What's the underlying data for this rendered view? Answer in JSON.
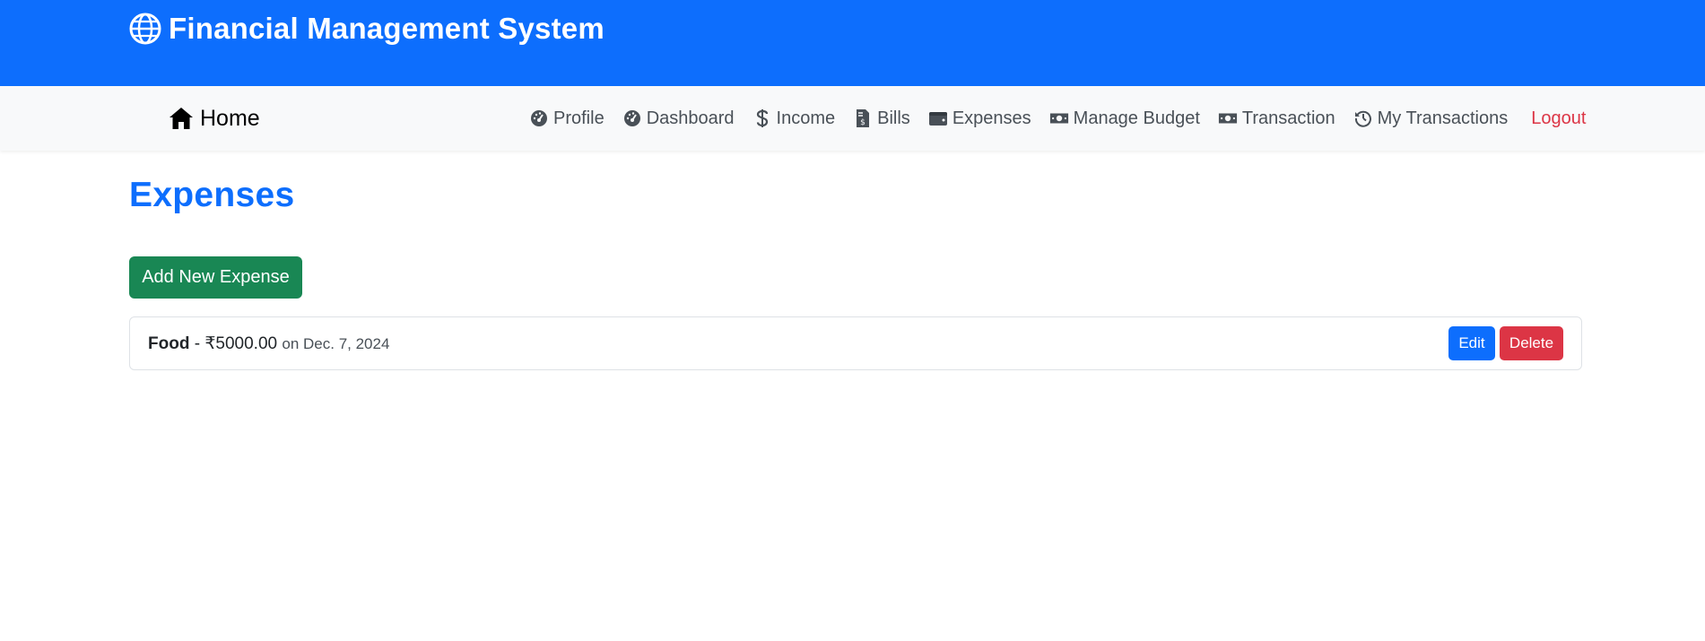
{
  "header": {
    "title": "Financial Management System",
    "icon": "globe-icon"
  },
  "nav": {
    "home_label": "Home",
    "home_icon": "home-icon",
    "links": [
      {
        "label": "Profile",
        "icon": "dashboard-icon"
      },
      {
        "label": "Dashboard",
        "icon": "dashboard-icon"
      },
      {
        "label": "Income",
        "icon": "dollar-icon"
      },
      {
        "label": "Bills",
        "icon": "invoice-icon"
      },
      {
        "label": "Expenses",
        "icon": "wallet-icon"
      },
      {
        "label": "Manage Budget",
        "icon": "money-bill-icon"
      },
      {
        "label": "Transaction",
        "icon": "money-bill-icon"
      },
      {
        "label": "My Transactions",
        "icon": "history-icon"
      }
    ],
    "logout_label": "Logout"
  },
  "main": {
    "page_title": "Expenses",
    "add_button": "Add New Expense",
    "expenses": [
      {
        "category": "Food",
        "separator": " - ",
        "amount": "₹5000.00",
        "date": "on Dec. 7, 2024",
        "edit_label": "Edit",
        "delete_label": "Delete"
      }
    ]
  },
  "colors": {
    "primary": "#0d6efd",
    "success": "#198754",
    "danger": "#dc3545",
    "navbar_bg": "#f8f9fa"
  }
}
